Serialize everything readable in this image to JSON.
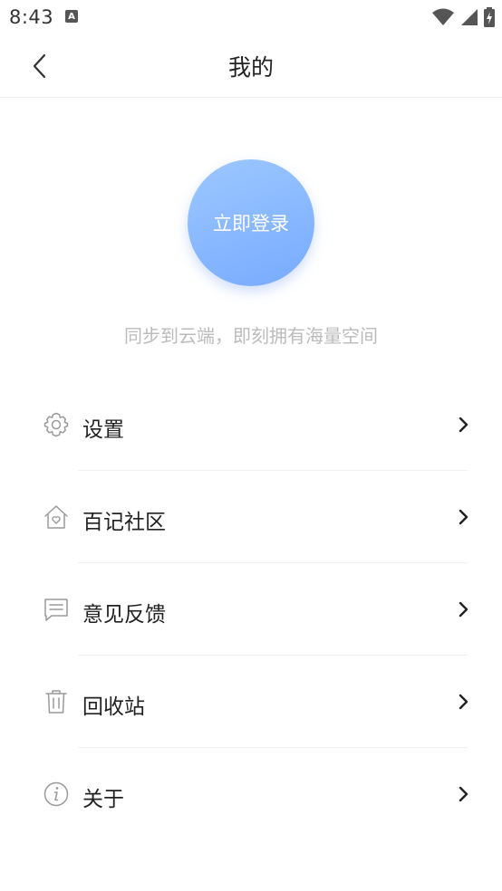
{
  "status_bar": {
    "time": "8:43",
    "notification_icon": "a-letter-icon",
    "wifi_icon": "wifi-icon",
    "signal_icon": "signal-icon",
    "battery_icon": "battery-charging-icon"
  },
  "header": {
    "title": "我的",
    "back_icon": "chevron-left-icon"
  },
  "login": {
    "button_label": "立即登录",
    "subtitle": "同步到云端，即刻拥有海量空间"
  },
  "menu": {
    "items": [
      {
        "label": "设置",
        "icon": "gear-icon"
      },
      {
        "label": "百记社区",
        "icon": "home-heart-icon"
      },
      {
        "label": "意见反馈",
        "icon": "message-icon"
      },
      {
        "label": "回收站",
        "icon": "trash-icon"
      },
      {
        "label": "关于",
        "icon": "info-icon"
      }
    ],
    "chevron_icon": "chevron-right-icon"
  },
  "colors": {
    "accent_start": "#9cc8ff",
    "accent_end": "#78aaff",
    "icon_gray": "#9a9a9a",
    "subtitle_gray": "#bbbbbb"
  }
}
